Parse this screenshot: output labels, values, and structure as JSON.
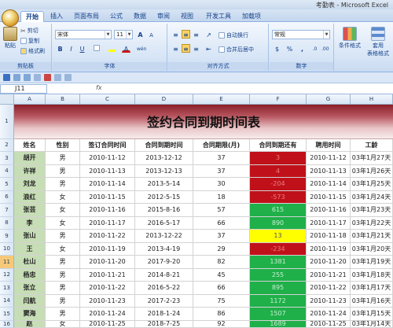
{
  "window": {
    "title": "考勤表 - Microsoft Excel"
  },
  "tabs": [
    "开始",
    "插入",
    "页面布局",
    "公式",
    "数据",
    "审阅",
    "视图",
    "开发工具",
    "加载项"
  ],
  "active_tab": "开始",
  "ribbon": {
    "clipboard": {
      "label": "剪贴板",
      "paste": "粘贴",
      "cut": "剪切",
      "copy": "复制",
      "format_painter": "格式刷"
    },
    "font": {
      "label": "字体",
      "font_name": "宋体",
      "font_size": "11",
      "bold": "B",
      "italic": "I",
      "underline": "U",
      "grow": "A",
      "shrink": "A",
      "wen": "wén"
    },
    "alignment": {
      "label": "对齐方式",
      "wrap": "自动换行",
      "merge": "合并后居中"
    },
    "number": {
      "label": "数字",
      "format": "常规",
      "currency": "$",
      "percent": "%",
      "comma": ","
    },
    "styles": {
      "conditional": "条件格式",
      "table_format_1": "套用",
      "table_format_2": "表格格式"
    }
  },
  "formula_bar": {
    "name_box": "J11",
    "fx": "fx",
    "formula": ""
  },
  "columns": [
    "A",
    "B",
    "C",
    "D",
    "E",
    "F",
    "G",
    "H"
  ],
  "row_numbers": [
    "1",
    "2",
    "3",
    "4",
    "5",
    "6",
    "7",
    "8",
    "9",
    "10",
    "11",
    "12",
    "13",
    "14",
    "15",
    "16"
  ],
  "selected_row": "11",
  "sheet": {
    "title": "签约合同到期时间表",
    "headers": [
      "姓名",
      "性别",
      "签订合同时间",
      "合同到期时间",
      "合同期限(月)",
      "合同到期还有",
      "聘用时间",
      "工龄"
    ],
    "rows": [
      {
        "name": "胡开",
        "gender": "男",
        "sign": "2010-11-12",
        "expire": "2013-12-12",
        "term": "37",
        "remain": "3",
        "hire": "2010-11-12",
        "seniority": "03年1月27天",
        "status": "red"
      },
      {
        "name": "许祥",
        "gender": "男",
        "sign": "2010-11-13",
        "expire": "2013-12-13",
        "term": "37",
        "remain": "4",
        "hire": "2010-11-13",
        "seniority": "03年1月26天",
        "status": "red"
      },
      {
        "name": "刘龙",
        "gender": "男",
        "sign": "2010-11-14",
        "expire": "2013-5-14",
        "term": "30",
        "remain": "-204",
        "hire": "2010-11-14",
        "seniority": "03年1月25天",
        "status": "red"
      },
      {
        "name": "浪红",
        "gender": "女",
        "sign": "2010-11-15",
        "expire": "2012-5-15",
        "term": "18",
        "remain": "-573",
        "hire": "2010-11-15",
        "seniority": "03年1月24天",
        "status": "red"
      },
      {
        "name": "张芸",
        "gender": "女",
        "sign": "2010-11-16",
        "expire": "2015-8-16",
        "term": "57",
        "remain": "615",
        "hire": "2010-11-16",
        "seniority": "03年1月23天",
        "status": "green"
      },
      {
        "name": "李",
        "gender": "女",
        "sign": "2010-11-17",
        "expire": "2016-5-17",
        "term": "66",
        "remain": "890",
        "hire": "2010-11-17",
        "seniority": "03年1月22天",
        "status": "green"
      },
      {
        "name": "张山",
        "gender": "男",
        "sign": "2010-11-22",
        "expire": "2013-12-22",
        "term": "37",
        "remain": "13",
        "hire": "2010-11-18",
        "seniority": "03年1月21天",
        "status": "yellow"
      },
      {
        "name": "王",
        "gender": "女",
        "sign": "2010-11-19",
        "expire": "2013-4-19",
        "term": "29",
        "remain": "-234",
        "hire": "2010-11-19",
        "seniority": "03年1月20天",
        "status": "red"
      },
      {
        "name": "杜山",
        "gender": "男",
        "sign": "2010-11-20",
        "expire": "2017-9-20",
        "term": "82",
        "remain": "1381",
        "hire": "2010-11-20",
        "seniority": "03年1月19天",
        "status": "green"
      },
      {
        "name": "杨忠",
        "gender": "男",
        "sign": "2010-11-21",
        "expire": "2014-8-21",
        "term": "45",
        "remain": "255",
        "hire": "2010-11-21",
        "seniority": "03年1月18天",
        "status": "green"
      },
      {
        "name": "张立",
        "gender": "男",
        "sign": "2010-11-22",
        "expire": "2016-5-22",
        "term": "66",
        "remain": "895",
        "hire": "2010-11-22",
        "seniority": "03年1月17天",
        "status": "green"
      },
      {
        "name": "闫航",
        "gender": "男",
        "sign": "2010-11-23",
        "expire": "2017-2-23",
        "term": "75",
        "remain": "1172",
        "hire": "2010-11-23",
        "seniority": "03年1月16天",
        "status": "green"
      },
      {
        "name": "窦海",
        "gender": "男",
        "sign": "2010-11-24",
        "expire": "2018-1-24",
        "term": "86",
        "remain": "1507",
        "hire": "2010-11-24",
        "seniority": "03年1月15天",
        "status": "green"
      },
      {
        "name": "赵",
        "gender": "女",
        "sign": "2010-11-25",
        "expire": "2018-7-25",
        "term": "92",
        "remain": "1689",
        "hire": "2010-11-25",
        "seniority": "03年1月14天",
        "status": "green"
      }
    ]
  },
  "colors": {
    "red": "#c0111a",
    "green": "#1fb04a",
    "yellow": "#ffff00",
    "name_col": "#c7ddb6"
  }
}
